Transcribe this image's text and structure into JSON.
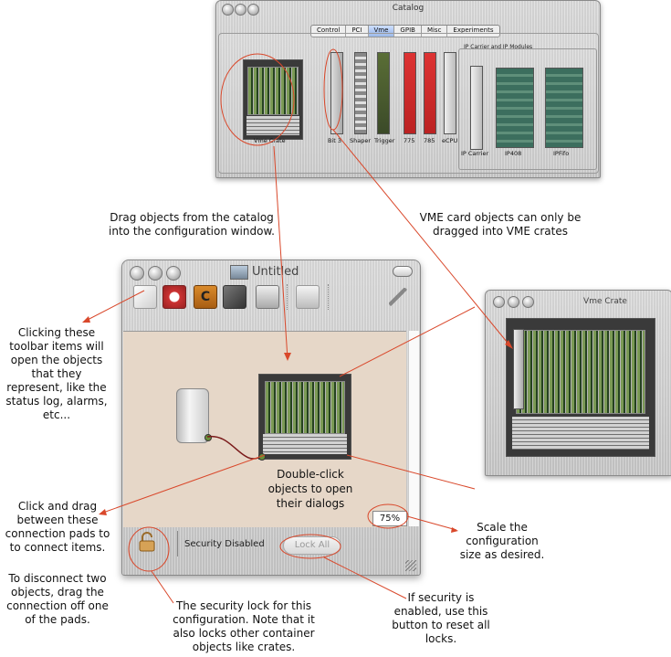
{
  "catalog": {
    "title": "Catalog",
    "tabs": [
      "Control",
      "PCI",
      "Vme",
      "GPIB",
      "Misc",
      "Experiments"
    ],
    "active_tab": "Vme",
    "group_title": "IP Carrier and IP Modules",
    "items": {
      "vme_crate": "Vme Crate",
      "bit3": "Bit 3",
      "shaper": "Shaper",
      "trigger": "Trigger",
      "c775": "775",
      "c785": "785",
      "ecpu": "eCPU",
      "ip_carrier": "IP Carrier",
      "ip408": "IP408",
      "ipfifo": "IPFifo"
    }
  },
  "main_window": {
    "title": "Untitled",
    "zoom": "75%",
    "security_status": "Security Disabled",
    "lock_all_label": "Lock All"
  },
  "vme_window": {
    "title": "Vme Crate"
  },
  "annotations": {
    "drag_catalog": "Drag objects from the catalog into the configuration window.",
    "vme_only": "VME card objects can only be dragged into VME crates",
    "toolbar_items": "Clicking these toolbar items will open the objects that they represent, like the status log, alarms, etc...",
    "double_click": "Double-click  objects to open their dialogs",
    "connect": "Click and drag between these connection pads to to connect items.",
    "disconnect": "To disconnect two objects, drag the connection off one of the pads.",
    "scale": "Scale the configuration size as desired.",
    "security_lock": "The security lock for this configuration. Note that it also locks other container objects like crates.",
    "reset_locks": "If security is enabled, use this button to reset all locks."
  },
  "colors": {
    "annotation_line": "#d9482b",
    "config_background": "#e6d7c8",
    "tab_active": "#8fb0e6"
  },
  "icons": [
    "status-log-icon",
    "alarm-clock-icon",
    "c-book-icon",
    "tools-icon",
    "monitor-icon",
    "print-icon",
    "wrench-icon",
    "padlock-icon",
    "mac-computer-icon"
  ]
}
